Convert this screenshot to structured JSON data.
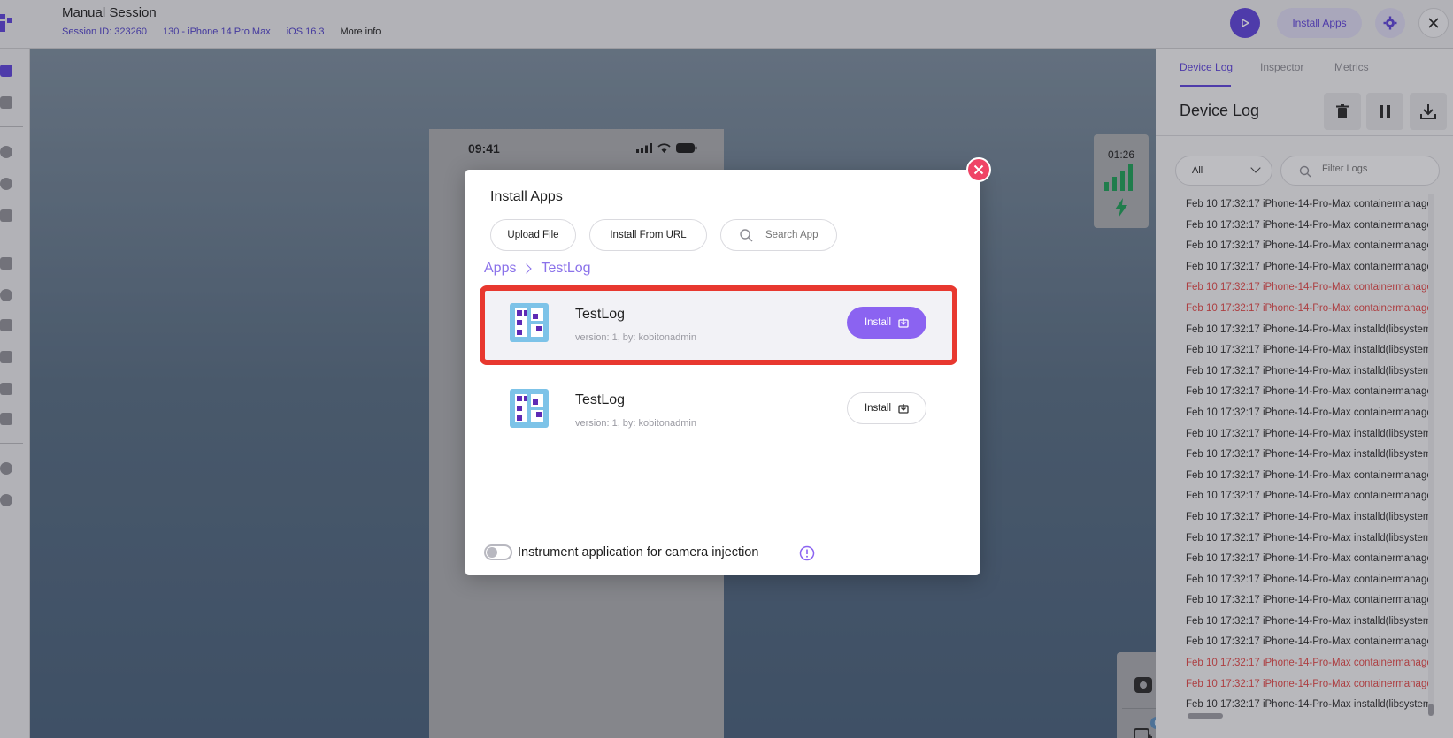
{
  "header": {
    "title": "Manual Session",
    "session_id": "Session ID: 323260",
    "device": "130 - iPhone 14 Pro Max",
    "os": "iOS 16.3",
    "more_info": "More info",
    "install_apps_label": "Install Apps"
  },
  "device": {
    "clock": "09:41"
  },
  "network": {
    "timer": "01:26"
  },
  "tools": {
    "badge_count": "0"
  },
  "right_panel": {
    "tabs": [
      "Device Log",
      "Inspector",
      "Metrics"
    ],
    "active_tab": "Device Log",
    "title": "Device Log",
    "level_filter": "All",
    "filter_placeholder": "Filter Logs",
    "logs": [
      {
        "text": "Feb 10 17:32:17 iPhone-14-Pro-Max containermanage",
        "error": false
      },
      {
        "text": "Feb 10 17:32:17 iPhone-14-Pro-Max containermanage",
        "error": false
      },
      {
        "text": "Feb 10 17:32:17 iPhone-14-Pro-Max containermanage",
        "error": false
      },
      {
        "text": "Feb 10 17:32:17 iPhone-14-Pro-Max containermanage",
        "error": false
      },
      {
        "text": "Feb 10 17:32:17 iPhone-14-Pro-Max containermanage",
        "error": true
      },
      {
        "text": "Feb 10 17:32:17 iPhone-14-Pro-Max containermanage",
        "error": true
      },
      {
        "text": "Feb 10 17:32:17 iPhone-14-Pro-Max installd(libsystem_",
        "error": false
      },
      {
        "text": "Feb 10 17:32:17 iPhone-14-Pro-Max installd(libsystem_",
        "error": false
      },
      {
        "text": "Feb 10 17:32:17 iPhone-14-Pro-Max installd(libsystem_",
        "error": false
      },
      {
        "text": "Feb 10 17:32:17 iPhone-14-Pro-Max containermanage",
        "error": false
      },
      {
        "text": "Feb 10 17:32:17 iPhone-14-Pro-Max containermanage",
        "error": false
      },
      {
        "text": "Feb 10 17:32:17 iPhone-14-Pro-Max installd(libsystem_",
        "error": false
      },
      {
        "text": "Feb 10 17:32:17 iPhone-14-Pro-Max installd(libsystem_",
        "error": false
      },
      {
        "text": "Feb 10 17:32:17 iPhone-14-Pro-Max containermanage",
        "error": false
      },
      {
        "text": "Feb 10 17:32:17 iPhone-14-Pro-Max containermanage",
        "error": false
      },
      {
        "text": "Feb 10 17:32:17 iPhone-14-Pro-Max installd(libsystem_",
        "error": false
      },
      {
        "text": "Feb 10 17:32:17 iPhone-14-Pro-Max installd(libsystem_",
        "error": false
      },
      {
        "text": "Feb 10 17:32:17 iPhone-14-Pro-Max containermanage",
        "error": false
      },
      {
        "text": "Feb 10 17:32:17 iPhone-14-Pro-Max containermanage",
        "error": false
      },
      {
        "text": "Feb 10 17:32:17 iPhone-14-Pro-Max containermanage",
        "error": false
      },
      {
        "text": "Feb 10 17:32:17 iPhone-14-Pro-Max installd(libsystem_",
        "error": false
      },
      {
        "text": "Feb 10 17:32:17 iPhone-14-Pro-Max containermanage",
        "error": false
      },
      {
        "text": "Feb 10 17:32:17 iPhone-14-Pro-Max containermanage",
        "error": true
      },
      {
        "text": "Feb 10 17:32:17 iPhone-14-Pro-Max containermanage",
        "error": true
      },
      {
        "text": "Feb 10 17:32:17 iPhone-14-Pro-Max installd(libsystem_",
        "error": false
      }
    ]
  },
  "modal": {
    "title": "Install Apps",
    "upload_file": "Upload File",
    "install_from_url": "Install From URL",
    "search_placeholder": "Search App",
    "breadcrumb": [
      "Apps",
      "TestLog"
    ],
    "apps": [
      {
        "name": "TestLog",
        "meta": "version: 1, by: kobitonadmin",
        "install_label": "Install"
      },
      {
        "name": "TestLog",
        "meta": "version: 1, by: kobitonadmin",
        "install_label": "Install"
      }
    ],
    "instrument_label": "Instrument application for camera injection",
    "instrument_enabled": false
  },
  "colors": {
    "accent": "#5e43d8",
    "install_primary": "#8b63f1",
    "highlight": "#e8382f",
    "close": "#ef4466",
    "log_error": "#e04848"
  }
}
